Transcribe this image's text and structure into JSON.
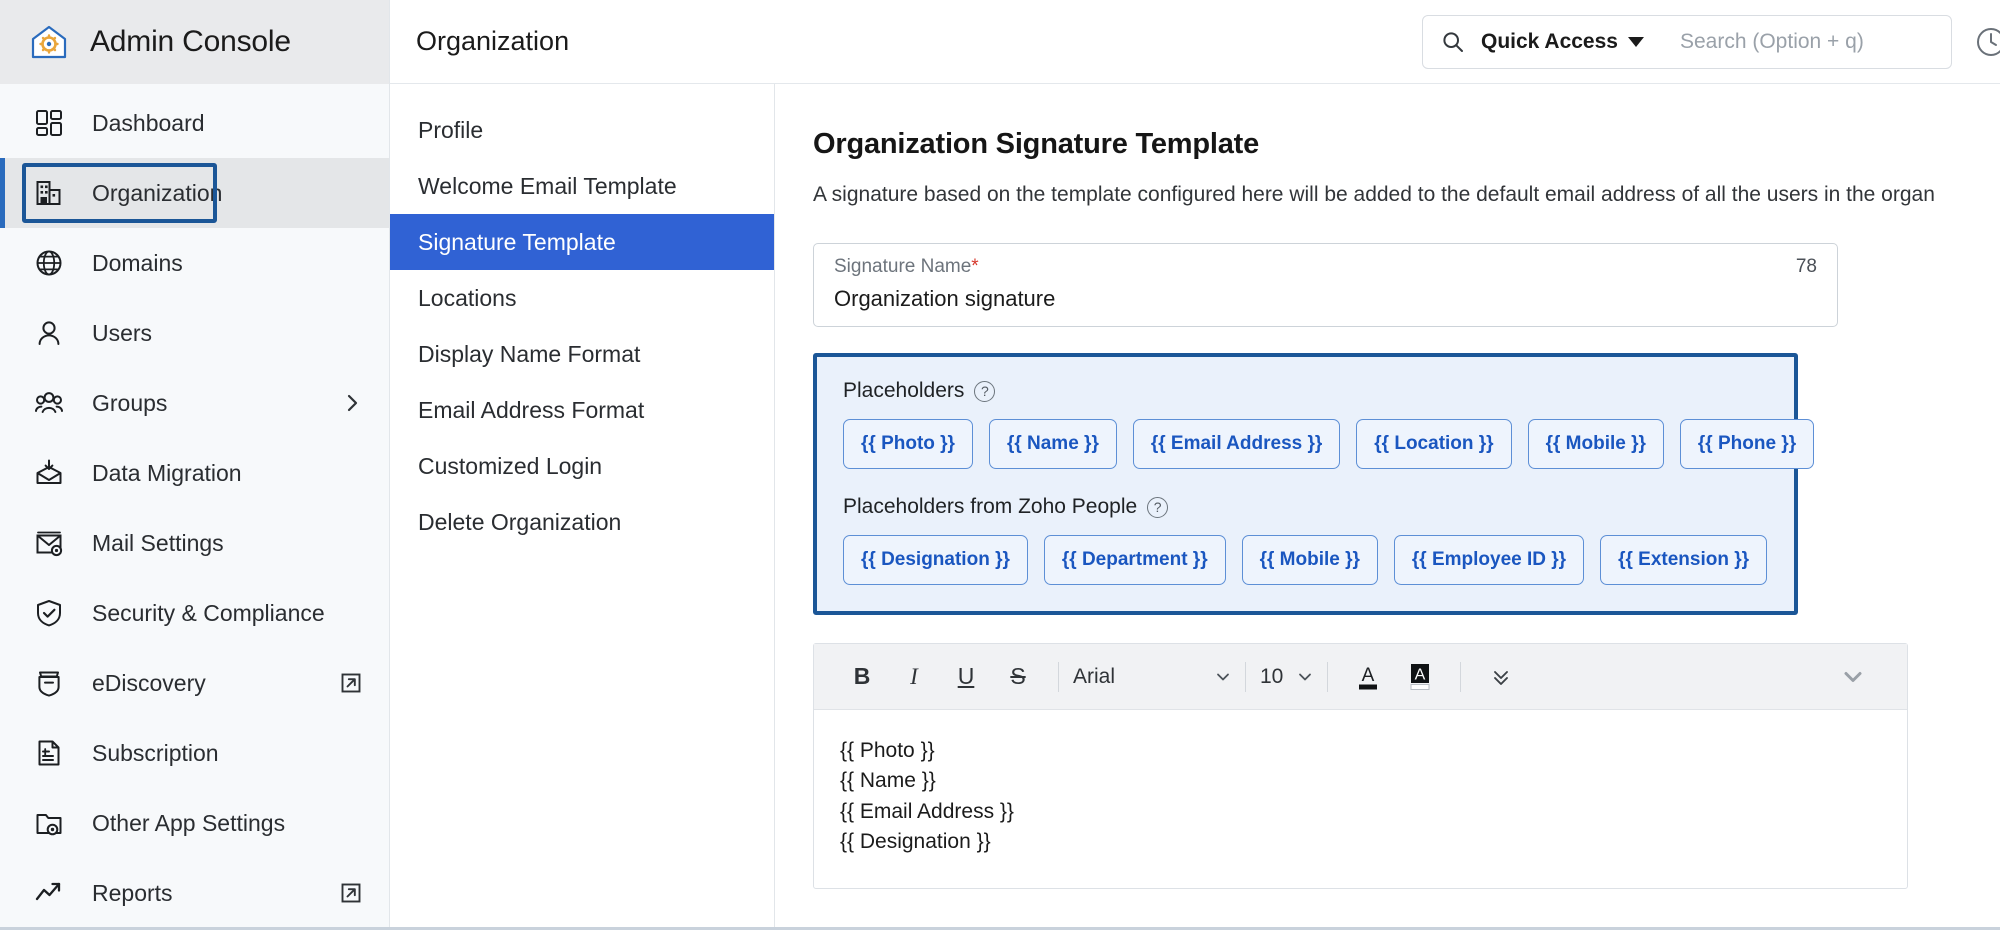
{
  "brand": {
    "title": "Admin Console",
    "logo_icon": "house-gear-icon"
  },
  "sidebar": {
    "items": [
      {
        "label": "Dashboard",
        "icon": "grid-dashboard-icon",
        "trail": ""
      },
      {
        "label": "Organization",
        "icon": "building-icon",
        "trail": ""
      },
      {
        "label": "Domains",
        "icon": "globe-icon",
        "trail": ""
      },
      {
        "label": "Users",
        "icon": "user-icon",
        "trail": ""
      },
      {
        "label": "Groups",
        "icon": "group-users-icon",
        "trail": "chevron-right-icon"
      },
      {
        "label": "Data Migration",
        "icon": "envelope-download-icon",
        "trail": ""
      },
      {
        "label": "Mail Settings",
        "icon": "mail-gear-icon",
        "trail": ""
      },
      {
        "label": "Security & Compliance",
        "icon": "shield-check-icon",
        "trail": ""
      },
      {
        "label": "eDiscovery",
        "icon": "briefcase-icon",
        "trail": "external-link-icon"
      },
      {
        "label": "Subscription",
        "icon": "invoice-dollar-icon",
        "trail": ""
      },
      {
        "label": "Other App Settings",
        "icon": "folder-gear-icon",
        "trail": ""
      },
      {
        "label": "Reports",
        "icon": "trend-arrow-icon",
        "trail": "external-link-icon"
      }
    ],
    "active_index": 1
  },
  "subnav": {
    "items": [
      {
        "label": "Profile"
      },
      {
        "label": "Welcome Email Template"
      },
      {
        "label": "Signature Template"
      },
      {
        "label": "Locations"
      },
      {
        "label": "Display Name Format"
      },
      {
        "label": "Email Address Format"
      },
      {
        "label": "Customized Login"
      },
      {
        "label": "Delete Organization"
      }
    ],
    "active_index": 2
  },
  "topbar": {
    "page_title": "Organization",
    "quick_access_label": "Quick Access",
    "search_placeholder": "Search (Option + q)",
    "search_value": "",
    "search_icon": "search-icon",
    "help_icon": "clock-help-icon"
  },
  "content": {
    "title": "Organization Signature Template",
    "description": "A signature based on the template configured here will be added to the default email address of all the users in the organ",
    "signature_name": {
      "label": "Signature Name",
      "required_marker": "*",
      "value": "Organization signature",
      "char_count": "78"
    },
    "placeholders": {
      "heading": "Placeholders",
      "help_icon": "question-mark-icon",
      "chips": [
        "{{ Photo }}",
        "{{ Name }}",
        "{{ Email Address }}",
        "{{ Location }}",
        "{{ Mobile }}",
        "{{ Phone }}"
      ],
      "people_heading": "Placeholders from Zoho People",
      "people_help_icon": "question-mark-icon",
      "people_chips": [
        "{{ Designation }}",
        "{{ Department }}",
        "{{ Mobile }}",
        "{{ Employee ID }}",
        "{{ Extension }}"
      ]
    },
    "editor": {
      "toolbar": {
        "bold": "B",
        "italic": "I",
        "underline": "U",
        "strikethrough": "S",
        "font_family": "Arial",
        "font_size": "10",
        "text_color_icon": "text-color-icon",
        "highlight_color_icon": "highlight-color-icon",
        "more_icon": "double-chevron-down-icon",
        "collapse_icon": "chevron-down-icon"
      },
      "lines": [
        "{{ Photo }}",
        "{{ Name }}",
        "{{ Email Address }}",
        "{{ Designation }}"
      ]
    }
  },
  "colors": {
    "accent_blue": "#3062d4",
    "focus_border": "#1b5697",
    "panel_bg": "#eaf1fb",
    "chip_text": "#1a56c0",
    "required_red": "#d6392d",
    "sidebar_bg": "#f7f9fb"
  }
}
